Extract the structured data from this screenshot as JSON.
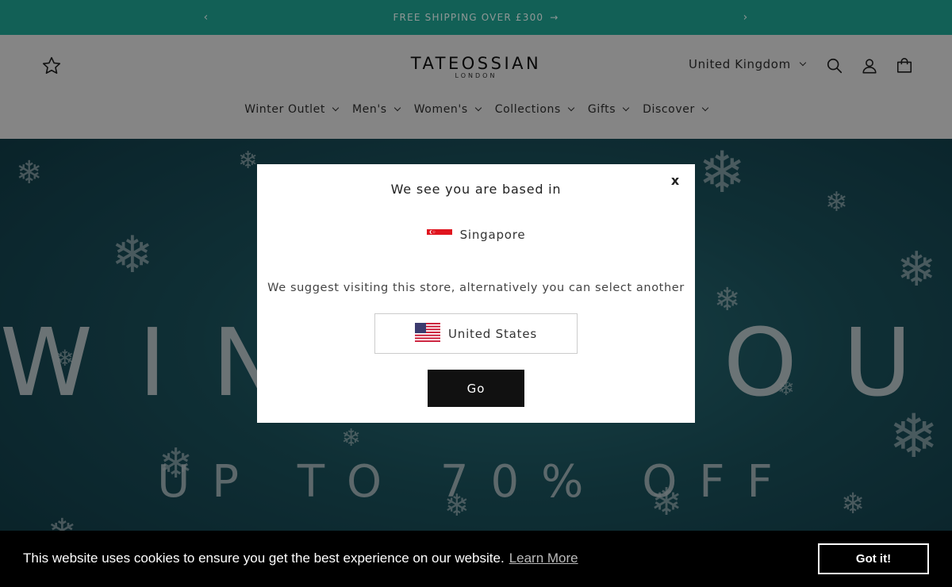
{
  "announcement": {
    "text": "FREE SHIPPING OVER £300",
    "arrow": "→",
    "prev": "‹",
    "next": "›"
  },
  "header": {
    "logo_main": "TATEOSSIAN",
    "logo_sub": "LONDON",
    "country": "United Kingdom",
    "icons": [
      "star-icon",
      "search-icon",
      "account-icon",
      "cart-icon"
    ]
  },
  "nav": {
    "items": [
      {
        "label": "Winter Outlet"
      },
      {
        "label": "Men's"
      },
      {
        "label": "Women's"
      },
      {
        "label": "Collections"
      },
      {
        "label": "Gifts"
      },
      {
        "label": "Discover"
      }
    ]
  },
  "hero": {
    "title": "WINTER OUTLET",
    "subtitle": "UP TO 70% OFF"
  },
  "modal": {
    "close": "x",
    "heading": "We see you are based in",
    "detected_country": "Singapore",
    "suggestion": "We suggest visiting this store, alternatively you can select another",
    "selected_store": "United States",
    "go_label": "Go"
  },
  "cookie": {
    "message": "This website uses cookies to ensure you get the best experience on our website.",
    "learn_more": "Learn More",
    "accept": "Got it!"
  },
  "colors": {
    "announcement_bg": "#1e9c8c",
    "hero_bg": "#1d5a66",
    "button_dark": "#111111",
    "cookie_bg": "#000000"
  }
}
